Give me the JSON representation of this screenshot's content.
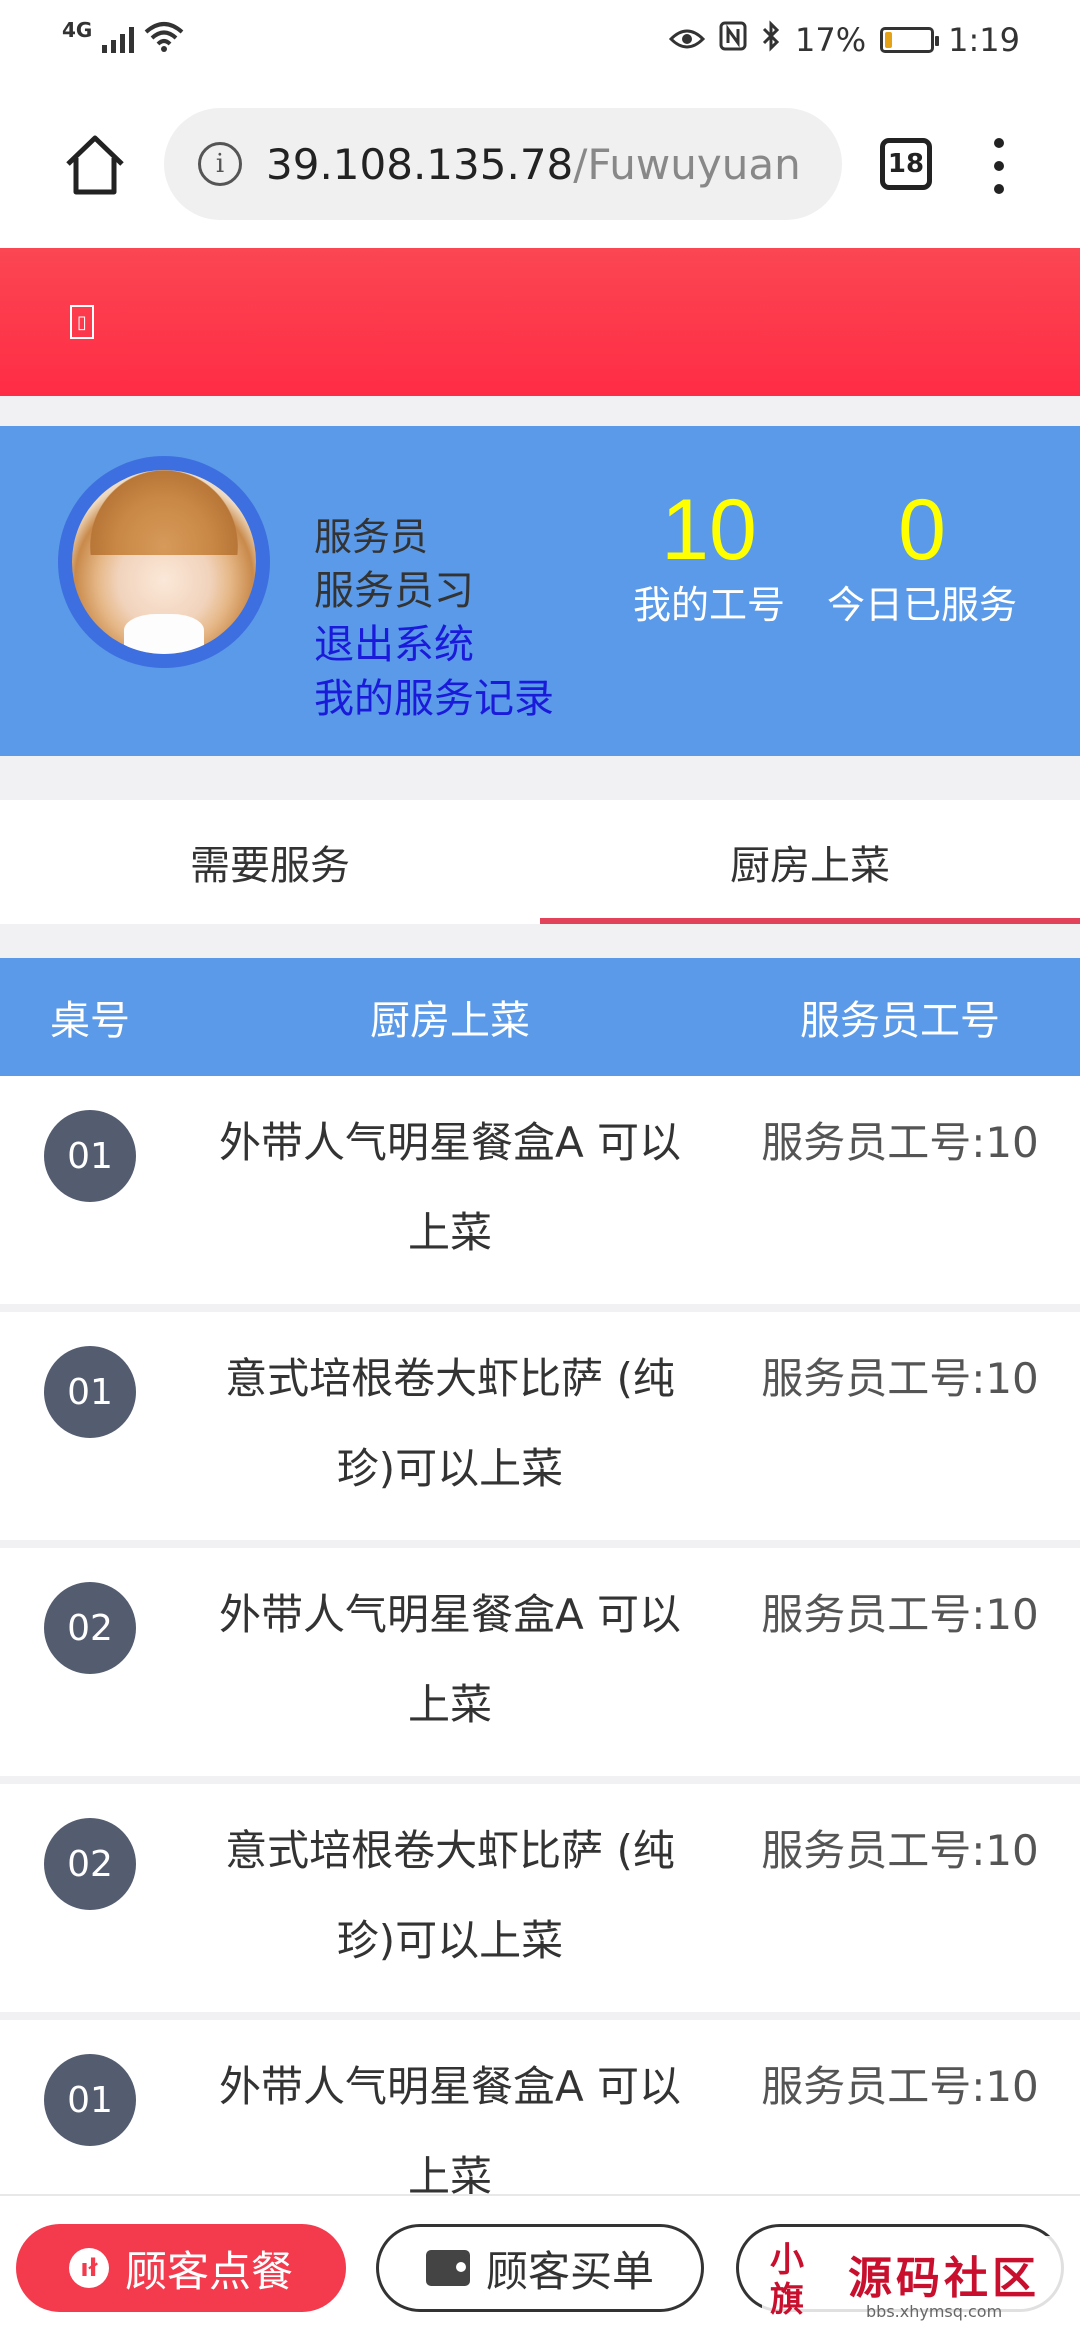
{
  "status_bar": {
    "network": "4G",
    "battery_percent": "17%",
    "battery_level": 0.17,
    "time": "1:19",
    "icons": [
      "eye-icon",
      "nfc-icon",
      "bluetooth-icon"
    ]
  },
  "browser": {
    "url_host": "39.108.135.78",
    "url_path": "/Fuwuyuan",
    "tab_count": "18"
  },
  "header": {
    "back_glyph": "▯"
  },
  "profile": {
    "role": "服务员",
    "name": "服务员习",
    "logout_link": "退出系统",
    "records_link": "我的服务记录",
    "stats": [
      {
        "value": "10",
        "label": "我的工号"
      },
      {
        "value": "0",
        "label": "今日已服务"
      }
    ],
    "colors": {
      "card": "#5a9ae8",
      "stat_value": "#ffff00",
      "link": "#1a1adb"
    }
  },
  "tabs": [
    {
      "label": "需要服务",
      "active": false
    },
    {
      "label": "厨房上菜",
      "active": true
    }
  ],
  "table": {
    "headers": [
      "桌号",
      "厨房上菜",
      "服务员工号"
    ],
    "rows": [
      {
        "table_no": "01",
        "dish": "外带人气明星餐盒A 可以上菜",
        "waiter": "服务员工号:10"
      },
      {
        "table_no": "01",
        "dish": "意式培根卷大虾比萨 (纯珍)可以上菜",
        "waiter": "服务员工号:10"
      },
      {
        "table_no": "02",
        "dish": "外带人气明星餐盒A 可以上菜",
        "waiter": "服务员工号:10"
      },
      {
        "table_no": "02",
        "dish": "意式培根卷大虾比萨 (纯珍)可以上菜",
        "waiter": "服务员工号:10"
      },
      {
        "table_no": "01",
        "dish": "外带人气明星餐盒A 可以上菜",
        "waiter": "服务员工号:10"
      }
    ]
  },
  "bottom_nav": {
    "order_label": "顾客点餐",
    "pay_label": "顾客买单"
  },
  "watermark": {
    "seal": "小旗",
    "title": "源码社区",
    "subtitle": "bbs.xhymsq.com"
  },
  "accent_colors": {
    "header_red": "#fb4653",
    "tab_underline": "#e2435b",
    "order_button": "#f43a4d"
  }
}
